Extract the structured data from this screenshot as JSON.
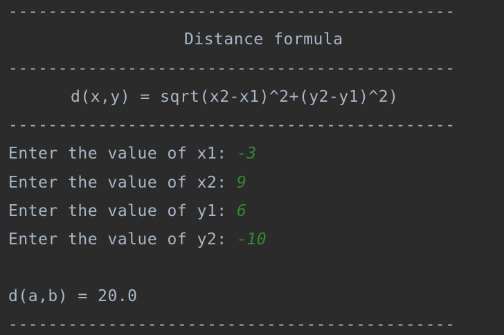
{
  "console": {
    "separator": "---------------------------------------------",
    "header_title": "Distance formula",
    "formula": "d(x,y) = sqrt(x2-x1)^2+(y2-y1)^2)",
    "prompts": [
      {
        "label": "Enter the value of x1: ",
        "value": "-3"
      },
      {
        "label": "Enter the value of x2: ",
        "value": "9"
      },
      {
        "label": "Enter the value of y1: ",
        "value": "6"
      },
      {
        "label": "Enter the value of y2: ",
        "value": "-10"
      }
    ],
    "result": "d(a,b) = 20.0",
    "colors": {
      "background": "#2b2b2b",
      "text": "#a9b7c6",
      "user_input": "#2e8b2e"
    }
  }
}
